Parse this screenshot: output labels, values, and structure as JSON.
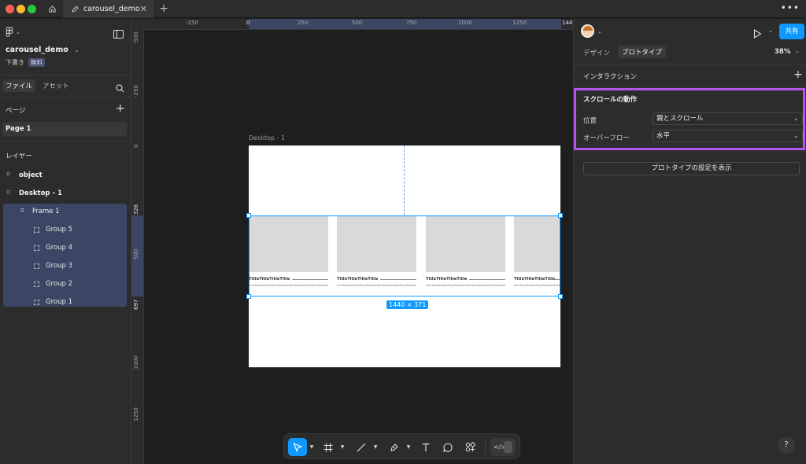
{
  "tabs": {
    "file_tab": "carousel_demo"
  },
  "file": {
    "name": "carousel_demo",
    "status": "下書き",
    "plan": "無料"
  },
  "left_tabs": {
    "file": "ファイル",
    "assets": "アセット"
  },
  "pages": {
    "header": "ページ",
    "items": [
      "Page 1"
    ]
  },
  "layers": {
    "header": "レイヤー",
    "items": [
      {
        "label": "object"
      },
      {
        "label": "Desktop - 1"
      },
      {
        "label": "Frame 1"
      },
      {
        "label": "Group 5"
      },
      {
        "label": "Group 4"
      },
      {
        "label": "Group 3"
      },
      {
        "label": "Group 2"
      },
      {
        "label": "Group 1"
      }
    ]
  },
  "ruler": {
    "h": [
      "-250",
      "0",
      "250",
      "500",
      "750",
      "1000",
      "1250",
      "144"
    ],
    "v": [
      "-500",
      "-250",
      "0",
      "326",
      "500",
      "697",
      "1000",
      "1250"
    ]
  },
  "canvas": {
    "frame_label": "Desktop - 1",
    "selection_size": "1440 × 371",
    "card_title": "TitleTitleTitleTitle",
    "card_text": "textTextTextTextTextTextTextTextTextTextTextTextTextTextTextTextTextTextTextTextTextTextTextText"
  },
  "right": {
    "tabs": {
      "design": "デザイン",
      "prototype": "プロトタイプ"
    },
    "zoom": "38%",
    "share": "共有",
    "interaction_header": "インタラクション",
    "scroll_section_title": "スクロールの動作",
    "position_label": "位置",
    "position_value": "親とスクロール",
    "overflow_label": "オーバーフロー",
    "overflow_value": "水平",
    "show_settings_button": "プロトタイプの設定を表示"
  },
  "colors": {
    "accent": "#0d99ff",
    "highlight": "#b455f0",
    "selection": "#3a4664"
  },
  "help": "?"
}
